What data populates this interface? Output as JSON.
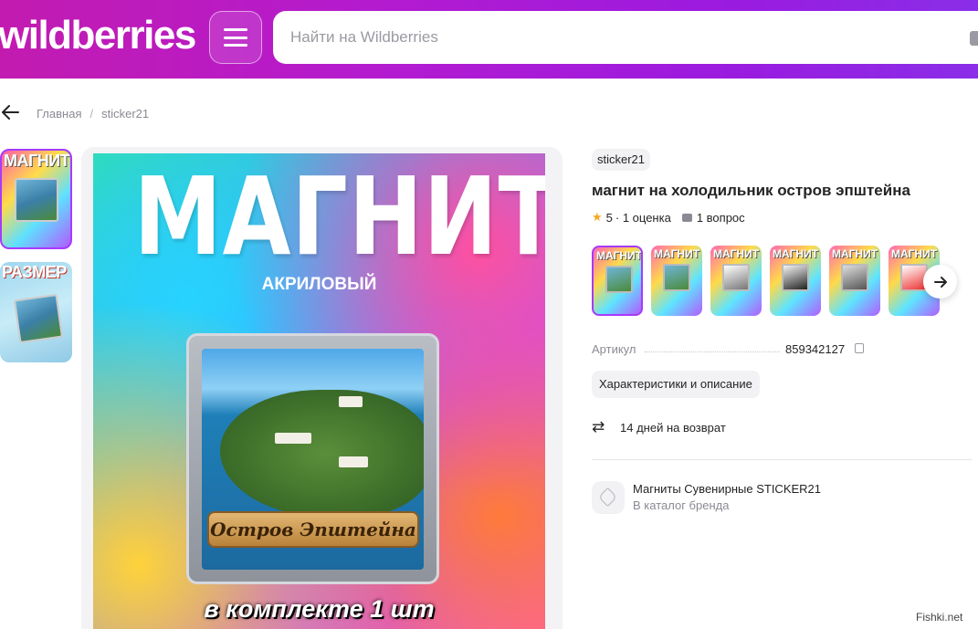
{
  "header": {
    "logo": "wildberries",
    "search_placeholder": "Найти на Wildberries",
    "colors": {
      "gradient_start": "#c21bb0",
      "gradient_end": "#8a2ee8"
    }
  },
  "breadcrumbs": {
    "items": [
      "Главная",
      "sticker21"
    ],
    "separator": "/"
  },
  "thumbnails": [
    {
      "label": "МАГНИТ",
      "selected": true
    },
    {
      "label": "РАЗМЕР",
      "selected": false
    }
  ],
  "main_image": {
    "headline": "МАГНИТ",
    "subheadline": "АКРИЛОВЫЙ",
    "banner": "Остров Эпштейна",
    "footer": "в комплекте 1 шт"
  },
  "product": {
    "brand": "sticker21",
    "title": "магнит на холодильник остров эпштейна",
    "rating": "5",
    "reviews": "· 1 оценка",
    "questions": "1 вопрос",
    "variants": [
      "МАГНИТ",
      "МАГНИТ",
      "МАГНИТ",
      "МАГНИТ",
      "МАГНИТ",
      "МАГНИТ"
    ],
    "article_label": "Артикул",
    "article_value": "859342127",
    "chars_button": "Характеристики и описание",
    "return_text": "14 дней на возврат",
    "brand_catalog_title": "Магниты Сувенирные STICKER21",
    "brand_catalog_link": "В каталог бренда"
  },
  "watermark": "Fishki.net",
  "colors": {
    "accent": "#a73afd",
    "star": "#f5a623",
    "muted": "#8a8a94"
  }
}
